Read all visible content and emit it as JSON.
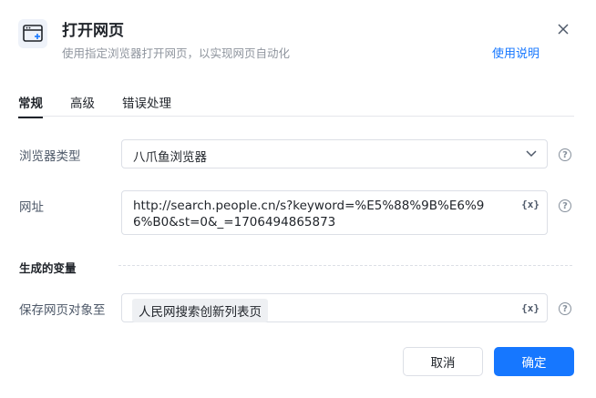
{
  "header": {
    "title": "打开网页",
    "subtitle": "使用指定浏览器打开网页，以实现网页自动化",
    "help_link": "使用说明"
  },
  "tabs": [
    {
      "label": "常规",
      "active": true
    },
    {
      "label": "高级",
      "active": false
    },
    {
      "label": "错误处理",
      "active": false
    }
  ],
  "form": {
    "browser_type": {
      "label": "浏览器类型",
      "value": "八爪鱼浏览器"
    },
    "url": {
      "label": "网址",
      "value": "http://search.people.cn/s?keyword=%E5%88%9B%E6%96%B0&st=0&_=1706494865873",
      "var_button": "{x}"
    }
  },
  "generated_vars": {
    "section_title": "生成的变量",
    "save_page": {
      "label": "保存网页对象至",
      "value": "人民网搜索创新列表页",
      "var_button": "{x}"
    }
  },
  "footer": {
    "cancel_label": "取消",
    "ok_label": "确定"
  },
  "colors": {
    "accent": "#1677ff",
    "icon_bg": "#eef2f9"
  },
  "icons": {
    "app": "browser-window-add-icon",
    "close": "close-icon",
    "help": "question-circle-icon",
    "dropdown": "chevron-down-icon"
  }
}
